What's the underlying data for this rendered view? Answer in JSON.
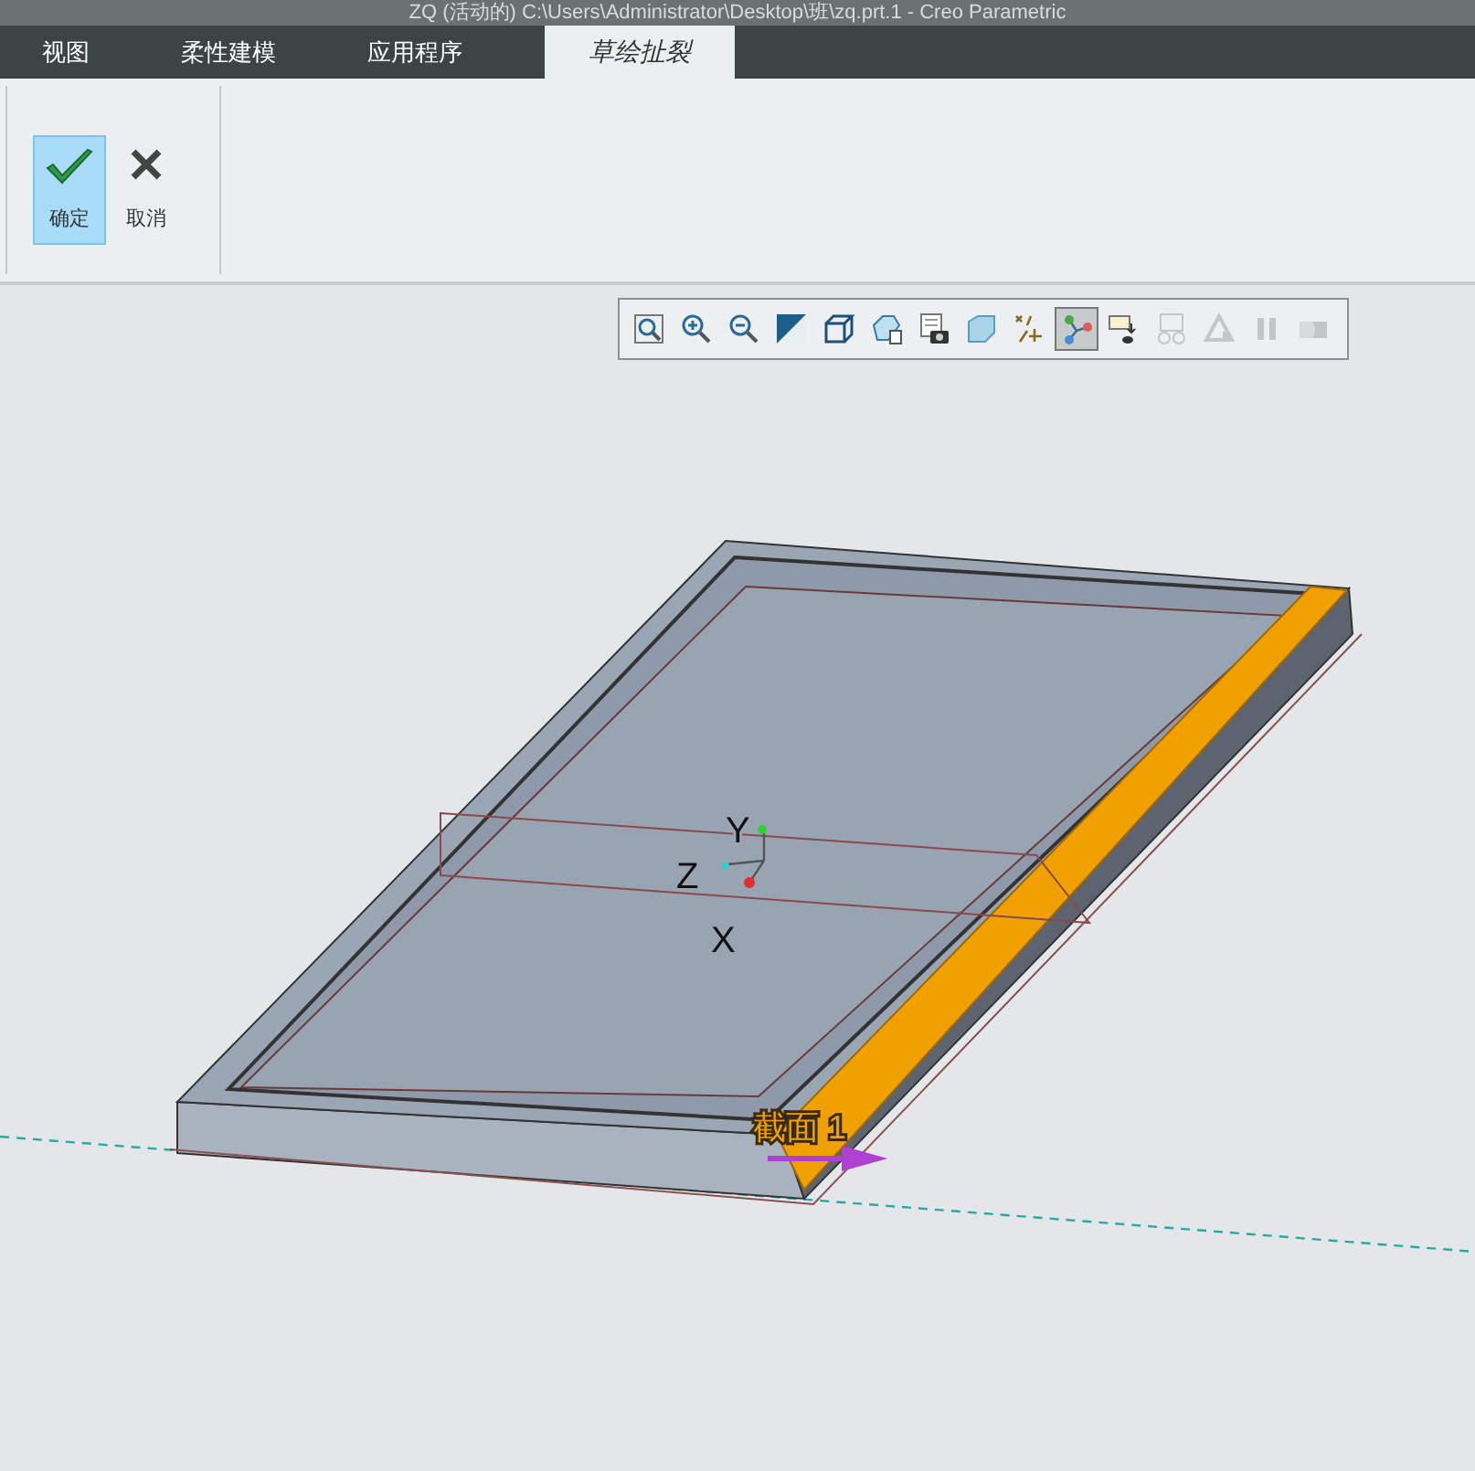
{
  "window": {
    "title": "ZQ (活动的) C:\\Users\\Administrator\\Desktop\\班\\zq.prt.1 - Creo Parametric"
  },
  "tabs": [
    {
      "label": "视图",
      "selected": false
    },
    {
      "label": "柔性建模",
      "selected": false
    },
    {
      "label": "应用程序",
      "selected": false
    },
    {
      "label": "草绘扯裂",
      "selected": true
    }
  ],
  "ribbon": {
    "buttons": [
      {
        "label": "确定",
        "kind": "confirm",
        "selected": true
      },
      {
        "label": "取消",
        "kind": "cancel",
        "selected": false
      }
    ]
  },
  "view_toolbar": {
    "tools": [
      {
        "kind": "refit",
        "selected": false,
        "disabled": false
      },
      {
        "kind": "zoom-in",
        "selected": false,
        "disabled": false
      },
      {
        "kind": "zoom-out",
        "selected": false,
        "disabled": false
      },
      {
        "kind": "repaint",
        "selected": false,
        "disabled": false
      },
      {
        "kind": "cube",
        "selected": false,
        "disabled": false
      },
      {
        "kind": "saved-views",
        "selected": false,
        "disabled": false
      },
      {
        "kind": "camera",
        "selected": false,
        "disabled": false
      },
      {
        "kind": "display-style",
        "selected": false,
        "disabled": false
      },
      {
        "kind": "datum",
        "selected": false,
        "disabled": false
      },
      {
        "kind": "spin-center",
        "selected": true,
        "disabled": false
      },
      {
        "kind": "annotation",
        "selected": false,
        "disabled": false
      },
      {
        "kind": "glasses",
        "selected": false,
        "disabled": true
      },
      {
        "kind": "triangle",
        "selected": false,
        "disabled": true
      },
      {
        "kind": "pause",
        "selected": false,
        "disabled": true
      },
      {
        "kind": "end",
        "selected": false,
        "disabled": true
      }
    ]
  },
  "viewport": {
    "axis_labels": [
      "Y",
      "Z",
      "X"
    ],
    "section_label": "截面 1"
  }
}
